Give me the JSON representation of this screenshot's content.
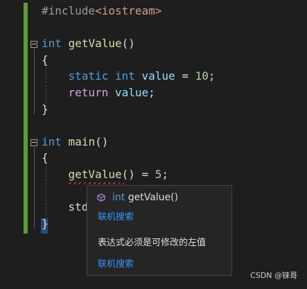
{
  "editor": {
    "lines": [
      {
        "tokens": [
          {
            "t": "#include",
            "c": "pre"
          },
          {
            "t": "<iostream>",
            "c": "inc"
          }
        ]
      },
      {
        "tokens": []
      },
      {
        "tokens": [
          {
            "t": "int",
            "c": "kw"
          },
          {
            "t": " ",
            "c": "punc"
          },
          {
            "t": "getValue",
            "c": "fn"
          },
          {
            "t": "()",
            "c": "punc"
          }
        ]
      },
      {
        "tokens": [
          {
            "t": "{",
            "c": "punc"
          }
        ]
      },
      {
        "tokens": [
          {
            "t": "    ",
            "c": "punc"
          },
          {
            "t": "static",
            "c": "kw"
          },
          {
            "t": " ",
            "c": "punc"
          },
          {
            "t": "int",
            "c": "kw"
          },
          {
            "t": " ",
            "c": "punc"
          },
          {
            "t": "value",
            "c": "var"
          },
          {
            "t": " = ",
            "c": "punc"
          },
          {
            "t": "10",
            "c": "num"
          },
          {
            "t": ";",
            "c": "punc"
          }
        ]
      },
      {
        "tokens": [
          {
            "t": "    ",
            "c": "punc"
          },
          {
            "t": "return",
            "c": "kw2"
          },
          {
            "t": " ",
            "c": "punc"
          },
          {
            "t": "value",
            "c": "var"
          },
          {
            "t": ";",
            "c": "punc"
          }
        ]
      },
      {
        "tokens": [
          {
            "t": "}",
            "c": "punc"
          }
        ]
      },
      {
        "tokens": []
      },
      {
        "tokens": [
          {
            "t": "int",
            "c": "kw"
          },
          {
            "t": " ",
            "c": "punc"
          },
          {
            "t": "main",
            "c": "fn"
          },
          {
            "t": "()",
            "c": "punc"
          }
        ]
      },
      {
        "tokens": [
          {
            "t": "{",
            "c": "punc"
          }
        ]
      },
      {
        "tokens": [
          {
            "t": "    ",
            "c": "punc"
          },
          {
            "t": "getValue",
            "c": "fn"
          },
          {
            "t": "() = ",
            "c": "punc"
          },
          {
            "t": "5",
            "c": "num"
          },
          {
            "t": ";",
            "c": "punc"
          }
        ]
      },
      {
        "tokens": []
      },
      {
        "tokens": [
          {
            "t": "    ",
            "c": "punc"
          },
          {
            "t": "std",
            "c": "punc"
          }
        ]
      },
      {
        "tokens": [
          {
            "t": "}",
            "c": "punc"
          }
        ]
      }
    ]
  },
  "popup": {
    "signature": "int getValue()",
    "signature_kw": "int",
    "signature_fn": "getValue()",
    "link_top": "联机搜索",
    "message": "表达式必须是可修改的左值",
    "link_bottom": "联机搜索",
    "icon": "cube-icon"
  },
  "watermark": "CSDN @铼哥",
  "colors": {
    "background": "#1e1e1e",
    "keyword": "#569cd6",
    "control_keyword": "#d8a0df",
    "function": "#dcdcaa",
    "variable": "#9cdcfe",
    "number": "#b5cea8",
    "link": "#3794ff",
    "error_squiggle": "#f14c4c",
    "change_bar": "#5f9a36"
  }
}
